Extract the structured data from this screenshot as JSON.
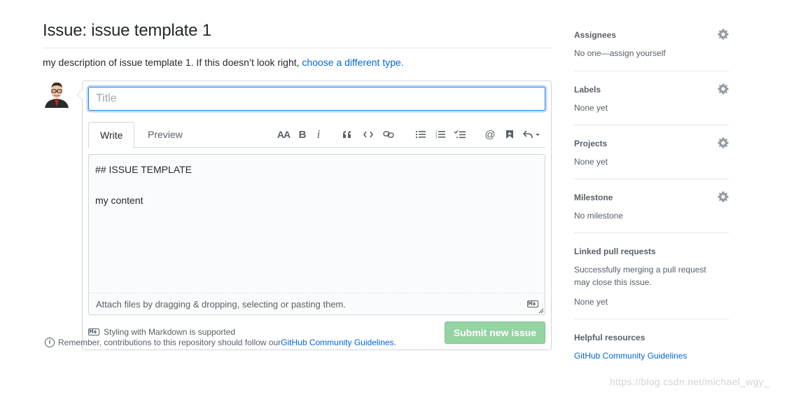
{
  "page": {
    "title": "Issue: issue template 1",
    "description_prefix": "my description of issue template 1. If this doesn’t look right, ",
    "description_link": "choose a different type."
  },
  "form": {
    "title_placeholder": "Title",
    "tabs": {
      "write": "Write",
      "preview": "Preview"
    },
    "toolbar_icons": [
      "text-size-icon",
      "bold-icon",
      "italic-icon",
      "quote-icon",
      "code-icon",
      "link-icon",
      "unordered-list-icon",
      "ordered-list-icon",
      "task-list-icon",
      "mention-icon",
      "saved-reply-icon",
      "reply-icon"
    ],
    "toolbar_labels": {
      "text_size": "AA",
      "bold": "B",
      "italic": "i",
      "mention": "@"
    },
    "body_line1": "## ISSUE TEMPLATE",
    "body_line2": "my content",
    "attach_text": "Attach files by dragging & dropping, selecting or pasting them.",
    "markdown_note": "Styling with Markdown is supported",
    "submit_label": "Submit new issue"
  },
  "reminder": {
    "prefix": "Remember, contributions to this repository should follow our ",
    "link": "GitHub Community Guidelines",
    "suffix": "."
  },
  "sidebar": {
    "assignees": {
      "heading": "Assignees",
      "value": "No one—assign yourself"
    },
    "labels": {
      "heading": "Labels",
      "value": "None yet"
    },
    "projects": {
      "heading": "Projects",
      "value": "None yet"
    },
    "milestone": {
      "heading": "Milestone",
      "value": "No milestone"
    },
    "linked": {
      "heading": "Linked pull requests",
      "note": "Successfully merging a pull request may close this issue.",
      "value": "None yet"
    },
    "helpful": {
      "heading": "Helpful resources",
      "link": "GitHub Community Guidelines"
    }
  },
  "watermark": "https://blog.csdn.net/michael_wgy_",
  "colors": {
    "link": "#0366d6",
    "submit_disabled": "#94d3a2",
    "focus_border": "#2188ff",
    "text_muted": "#586069"
  }
}
